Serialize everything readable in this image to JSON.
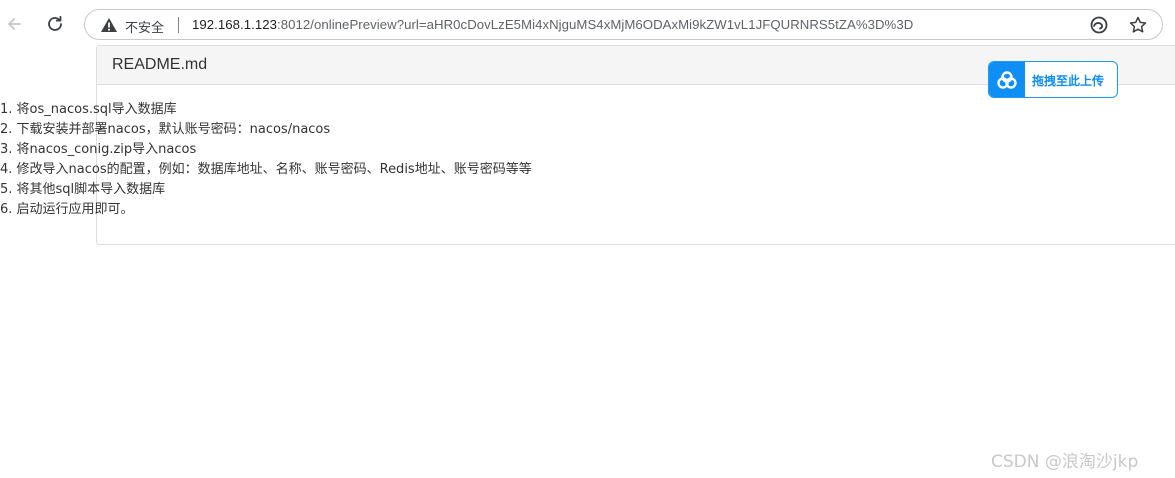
{
  "browser": {
    "security_label": "不安全",
    "url_host": "192.168.1.123",
    "url_rest": ":8012/onlinePreview?url=aHR0cDovLzE5Mi4xNjguMS4xMjM6ODAxMi9kZW1vL1JFQURNRS5tZA%3D%3D",
    "icons": [
      "back-arrow-icon",
      "reload-icon",
      "warning-triangle-icon",
      "edge-browser-icon",
      "star-icon"
    ]
  },
  "document": {
    "title": "README.md",
    "lines": [
      "1. 将os_nacos.sql导入数据库",
      "2. 下载安装并部署nacos，默认账号密码：nacos/nacos",
      "3. 将nacos_conig.zip导入nacos",
      "4. 修改导入nacos的配置，例如：数据库地址、名称、账号密码、Redis地址、账号密码等等",
      "5. 将其他sql脚本导入数据库",
      "6. 启动运行应用即可。"
    ]
  },
  "upload_widget": {
    "label": "拖拽至此上传",
    "icon": "cloud-upload-icon",
    "accent": "#0f8ef5"
  },
  "watermark": {
    "text": "CSDN @浪淘沙jkp"
  }
}
